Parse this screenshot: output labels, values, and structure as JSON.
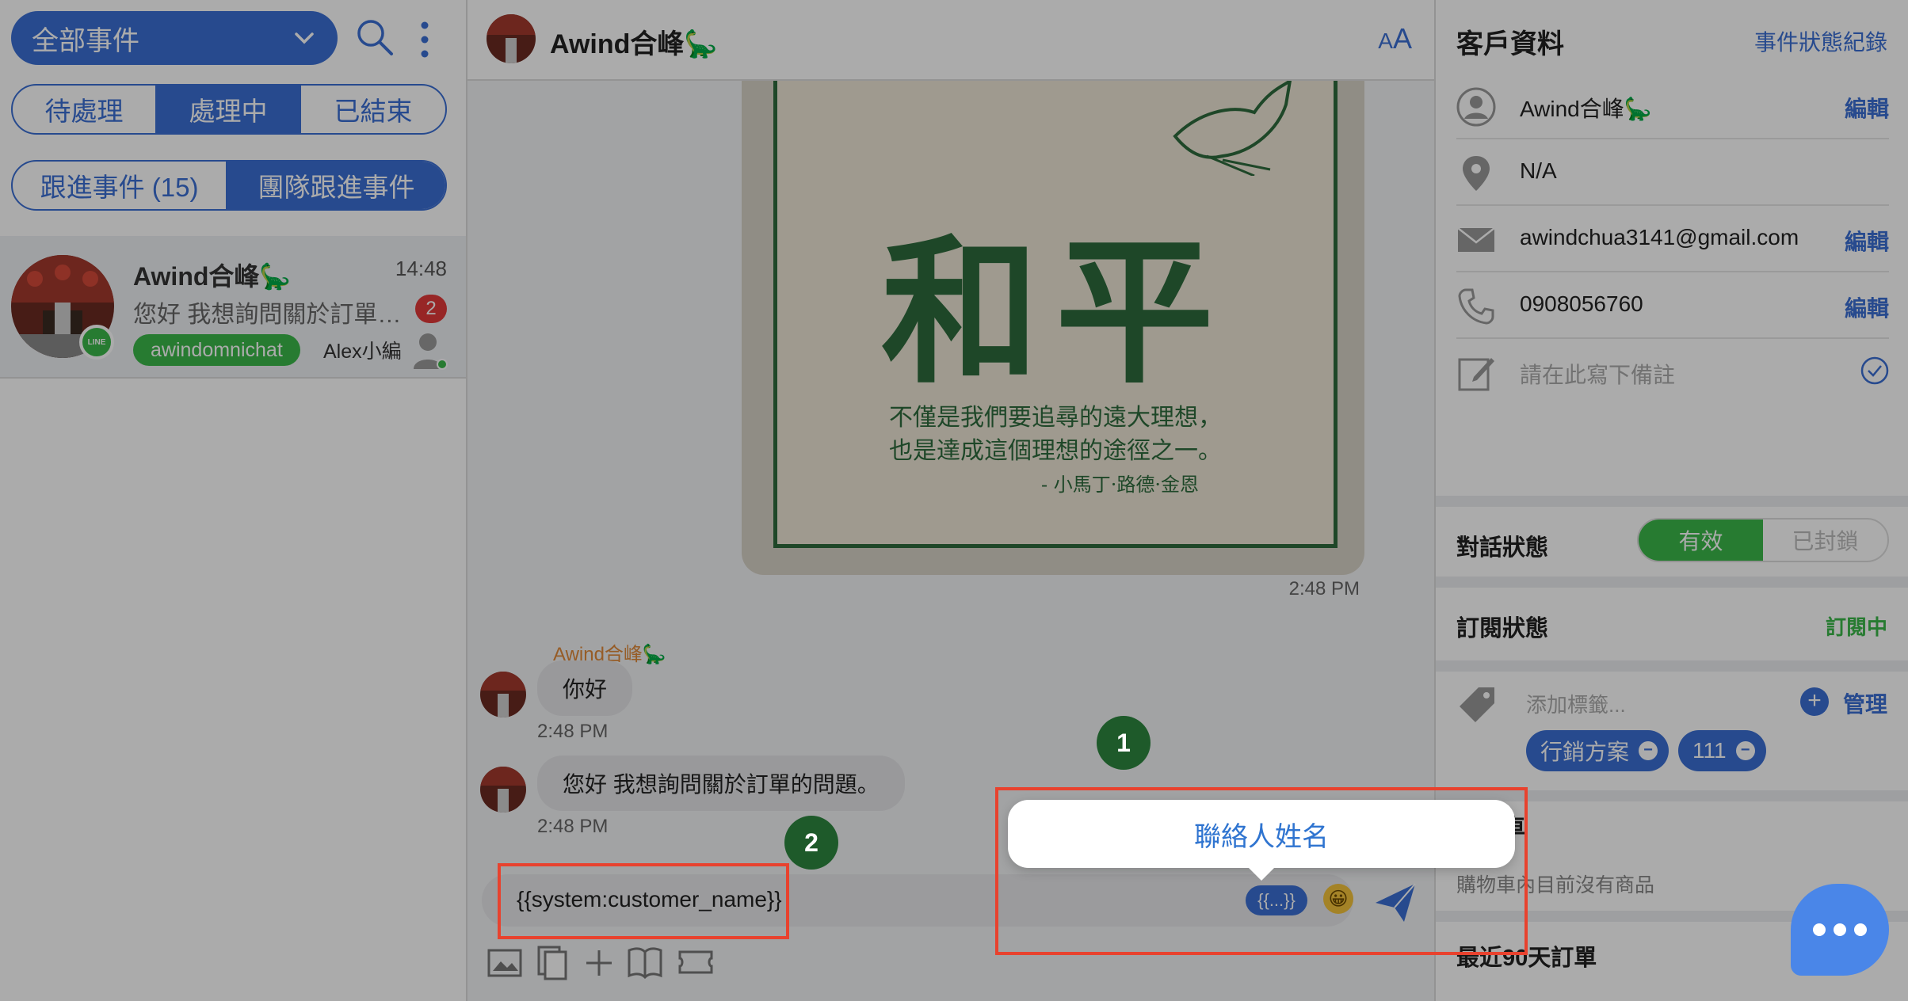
{
  "sidebar": {
    "event_filter": "全部事件",
    "status_tabs": [
      "待處理",
      "處理中",
      "已結束"
    ],
    "follow_tabs": [
      "跟進事件 (15)",
      "團隊跟進事件"
    ],
    "conversation": {
      "name": "Awind合峰🦕",
      "time": "14:48",
      "preview": "您好 我想詢問關於訂單的...",
      "unread": "2",
      "tag": "awindomnichat",
      "agent": "Alex小編"
    }
  },
  "chat": {
    "header_name": "Awind合峰🦕",
    "font_size_label_small": "A",
    "font_size_label_big": "A",
    "poster": {
      "title": "和平",
      "quote_line1": "不僅是我們要追尋的遠大理想，",
      "quote_line2": "也是達成這個理想的途徑之一。",
      "author": "- 小馬丁·路德·金恩"
    },
    "image_time": "2:48 PM",
    "sender_name": "Awind合峰🦕",
    "messages": [
      {
        "text": "你好",
        "time": "2:48 PM"
      },
      {
        "text": "您好 我想詢問關於訂單的問題。",
        "time": "2:48 PM"
      }
    ],
    "composer_value": "{{system:customer_name}}",
    "variable_button": "{{...}}",
    "emoji": "😀",
    "tooltip": "聯絡人姓名",
    "steps": [
      "1",
      "2"
    ]
  },
  "customer": {
    "title": "客戶資料",
    "history_link": "事件狀態紀錄",
    "name": "Awind合峰🦕",
    "location": "N/A",
    "email": "awindchua3141@gmail.com",
    "phone": "0908056760",
    "note_placeholder": "請在此寫下備註",
    "edit_label": "編輯",
    "conversation_status_label": "對話狀態",
    "conversation_status_on": "有效",
    "conversation_status_off": "已封鎖",
    "subscription_label": "訂閱狀態",
    "subscription_value": "訂閱中",
    "tag_placeholder": "添加標籤...",
    "manage_label": "管理",
    "tags": [
      "行銷方案",
      "111"
    ],
    "cart_label": "購物車",
    "cart_empty": "購物車內目前沒有商品",
    "orders_label": "最近90天訂單"
  },
  "colors": {
    "primary": "#3b6fd4",
    "green": "#3bb84a",
    "highlight": "#e8422e",
    "step": "#1e5a2a"
  }
}
